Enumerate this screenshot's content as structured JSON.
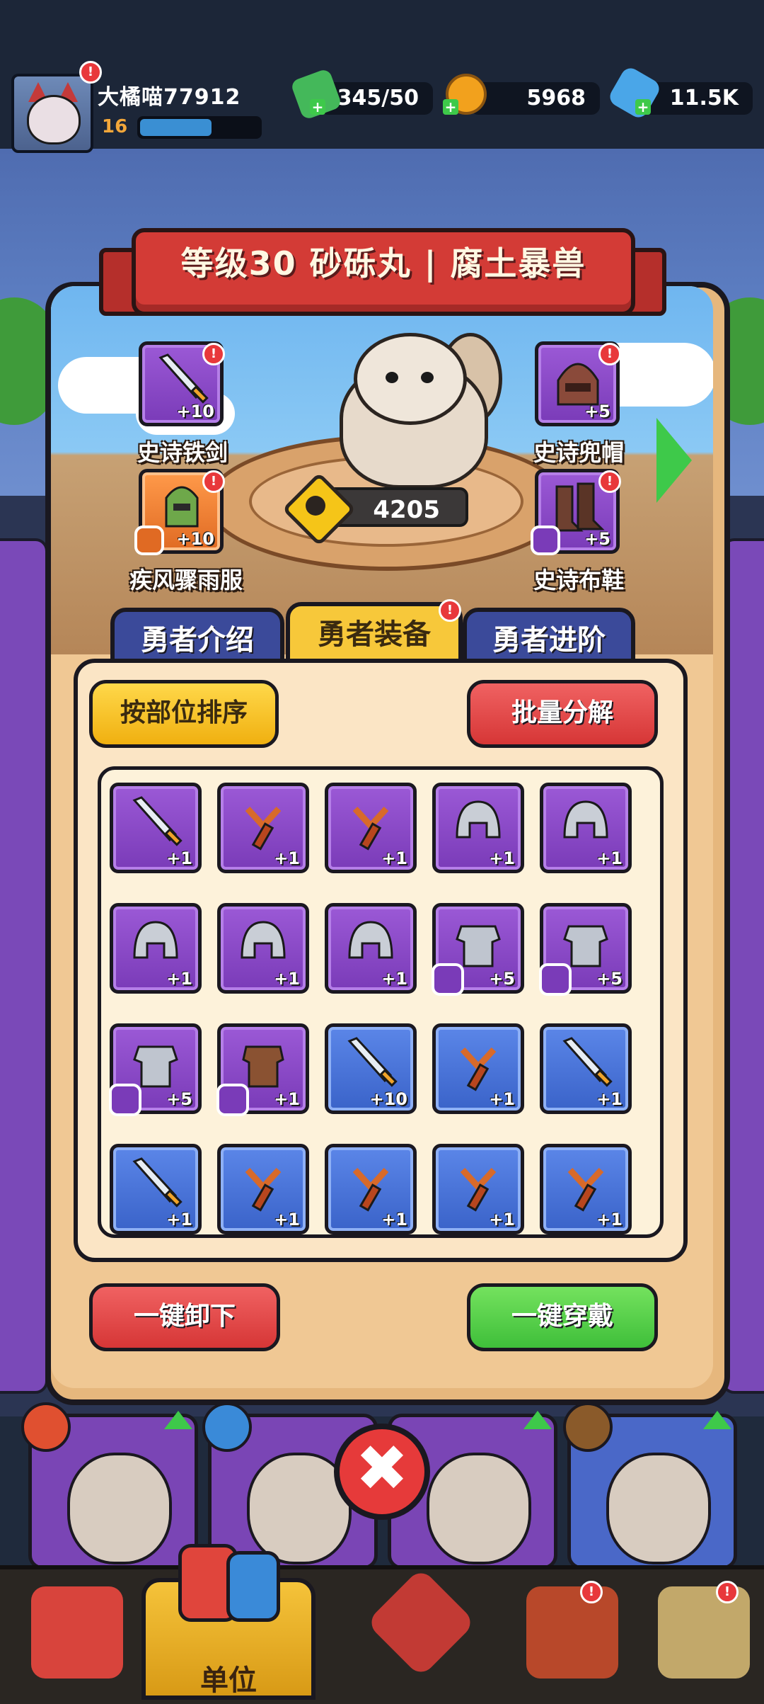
{
  "player": {
    "name": "大橘喵77912",
    "level": "16",
    "xp_fraction": 0.6
  },
  "resources": {
    "energy": "345/50",
    "coins": "5968",
    "gems": "11.5K"
  },
  "hero": {
    "title": "等级30 砂砾丸 | 腐土暴兽",
    "power": "4205"
  },
  "equipped": {
    "weapon": {
      "name": "史诗铁剑",
      "plus": "+10",
      "alert": "!"
    },
    "armor": {
      "name": "疾风骤雨服",
      "plus": "+10",
      "alert": "!"
    },
    "helmet": {
      "name": "史诗兜帽",
      "plus": "+5",
      "alert": "!"
    },
    "shoes": {
      "name": "史诗布鞋",
      "plus": "+5",
      "alert": "!"
    }
  },
  "tabs": [
    {
      "label": "勇者介绍"
    },
    {
      "label": "勇者装备",
      "alert": "!"
    },
    {
      "label": "勇者进阶"
    }
  ],
  "actions": {
    "sort": "按部位排序",
    "bulk_decompose": "批量分解",
    "unequip_all": "一键卸下",
    "equip_all": "一键穿戴"
  },
  "inventory": [
    {
      "icon": "sword-icon",
      "rarity": "purple",
      "plus": "+1"
    },
    {
      "icon": "slingshot-icon",
      "rarity": "purple",
      "plus": "+1"
    },
    {
      "icon": "slingshot-icon",
      "rarity": "purple",
      "plus": "+1"
    },
    {
      "icon": "helmet-icon",
      "rarity": "purple",
      "plus": "+1"
    },
    {
      "icon": "helmet-icon",
      "rarity": "purple",
      "plus": "+1"
    },
    {
      "icon": "helmet-icon",
      "rarity": "purple",
      "plus": "+1"
    },
    {
      "icon": "helmet-icon",
      "rarity": "purple",
      "plus": "+1"
    },
    {
      "icon": "helmet-icon",
      "rarity": "purple",
      "plus": "+1"
    },
    {
      "icon": "chest-armor-icon",
      "rarity": "purple",
      "plus": "+5",
      "badge": true
    },
    {
      "icon": "chest-armor-icon",
      "rarity": "purple",
      "plus": "+5",
      "badge": true
    },
    {
      "icon": "chest-armor-icon",
      "rarity": "purple",
      "plus": "+5",
      "badge": true
    },
    {
      "icon": "leather-vest-icon",
      "rarity": "purple",
      "plus": "+1",
      "badge": true
    },
    {
      "icon": "sword-icon",
      "rarity": "blue",
      "plus": "+10"
    },
    {
      "icon": "slingshot-icon",
      "rarity": "blue",
      "plus": "+1"
    },
    {
      "icon": "sword-icon",
      "rarity": "blue",
      "plus": "+1"
    },
    {
      "icon": "sword-icon",
      "rarity": "blue",
      "plus": "+1"
    },
    {
      "icon": "slingshot-icon",
      "rarity": "blue",
      "plus": "+1"
    },
    {
      "icon": "slingshot-icon",
      "rarity": "blue",
      "plus": "+1"
    },
    {
      "icon": "slingshot-icon",
      "rarity": "blue",
      "plus": "+1"
    },
    {
      "icon": "slingshot-icon",
      "rarity": "blue",
      "plus": "+1"
    }
  ],
  "nav": {
    "units_label": "单位",
    "alert": "!"
  },
  "colors": {
    "purple": "#8a48c8",
    "blue": "#4a74d8",
    "orange": "#f08038",
    "red": "#e63a3a",
    "green": "#4fcf44",
    "yellow": "#f7c83a"
  }
}
